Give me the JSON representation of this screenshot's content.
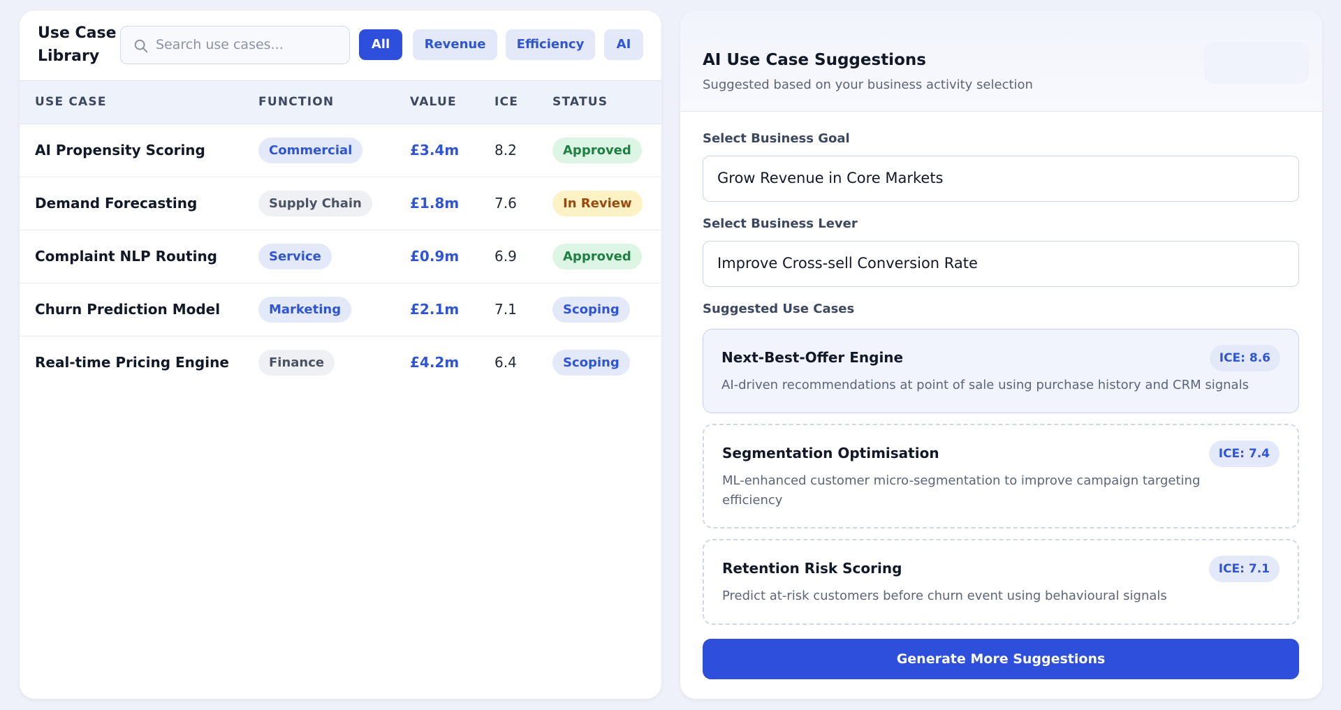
{
  "library": {
    "title": "Use Case Library",
    "search": {
      "placeholder": "Search use cases...",
      "value": ""
    },
    "filters": [
      "All",
      "Revenue",
      "Efficiency",
      "AI"
    ],
    "active_filter": "All",
    "columns": [
      "USE CASE",
      "FUNCTION",
      "VALUE",
      "ICE",
      "STATUS"
    ],
    "rows": [
      {
        "name": "AI Propensity Scoring",
        "function": "Commercial",
        "value": "£3.4m",
        "ice": "8.2",
        "status": "Approved"
      },
      {
        "name": "Demand Forecasting",
        "function": "Supply Chain",
        "value": "£1.8m",
        "ice": "7.6",
        "status": "In Review"
      },
      {
        "name": "Complaint NLP Routing",
        "function": "Service",
        "value": "£0.9m",
        "ice": "6.9",
        "status": "Approved"
      },
      {
        "name": "Churn Prediction Model",
        "function": "Marketing",
        "value": "£2.1m",
        "ice": "7.1",
        "status": "Scoping"
      },
      {
        "name": "Real-time Pricing Engine",
        "function": "Finance",
        "value": "£4.2m",
        "ice": "6.4",
        "status": "Scoping"
      }
    ]
  },
  "suggestions": {
    "title": "AI Use Case Suggestions",
    "subtitle": "Suggested based on your business activity selection",
    "goal_label": "Select Business Goal",
    "goal_value": "Grow Revenue in Core Markets",
    "lever_label": "Select Business Lever",
    "lever_value": "Improve Cross-sell Conversion Rate",
    "list_label": "Suggested Use Cases",
    "items": [
      {
        "title": "Next-Best-Offer Engine",
        "ice": "ICE: 8.6",
        "description": "AI-driven recommendations at point of sale using purchase history and CRM signals"
      },
      {
        "title": "Segmentation Optimisation",
        "ice": "ICE: 7.4",
        "description": "ML-enhanced customer micro-segmentation to improve campaign targeting efficiency"
      },
      {
        "title": "Retention Risk Scoring",
        "ice": "ICE: 7.1",
        "description": "Predict at-risk customers before churn event using behavioural signals"
      }
    ],
    "generate_label": "Generate More Suggestions"
  },
  "colors": {
    "accent": "#2d4fdc",
    "page_background": "#eef1f9",
    "approved": "#1e8041",
    "in_review": "#9a4a0c",
    "scoping": "#2f55d4"
  },
  "icons": {
    "search": "search-icon"
  }
}
